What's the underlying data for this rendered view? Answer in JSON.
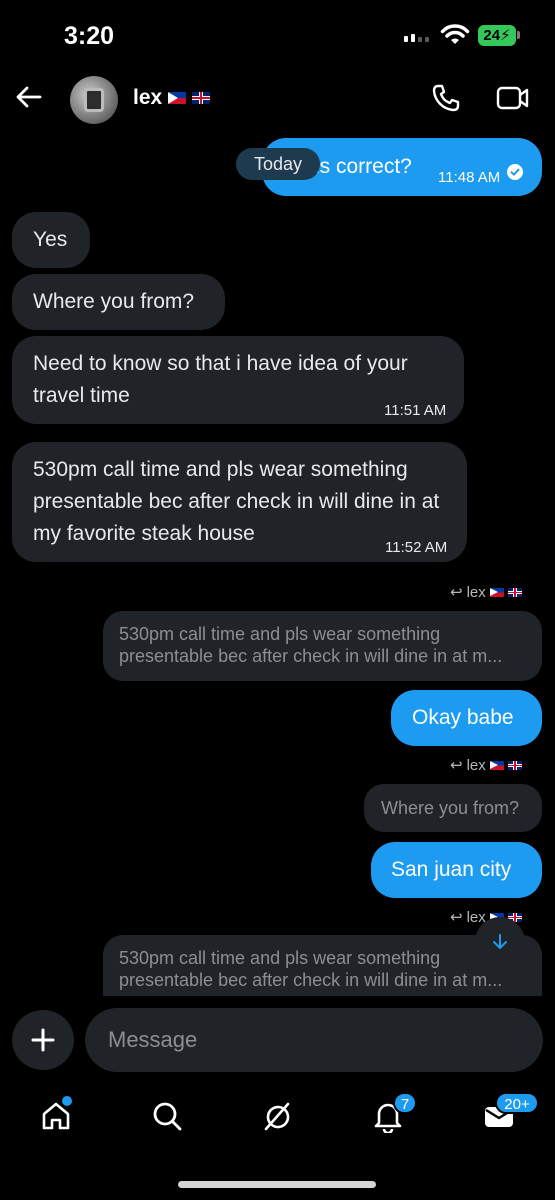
{
  "status_bar": {
    "time": "3:20",
    "battery": "24"
  },
  "header": {
    "contact_name": "lex",
    "back_icon": "arrow-left-icon",
    "call_icon": "phone-icon",
    "video_icon": "video-icon"
  },
  "date_separator": "Today",
  "messages": [
    {
      "direction": "out",
      "text": "is correct?",
      "time": "11:48 AM"
    },
    {
      "direction": "in",
      "text": "Yes"
    },
    {
      "direction": "in",
      "text": "Where you from?"
    },
    {
      "direction": "in",
      "text": "Need to know so that i have idea of your travel time",
      "time": "11:51 AM"
    },
    {
      "direction": "in",
      "text": "530pm call time and pls wear something presentable bec after check in will dine in at my favorite steak house",
      "time": "11:52 AM"
    },
    {
      "direction": "out",
      "reply_to": "lex",
      "quoted": "530pm call time and pls wear something presentable bec after check in will dine in at m...",
      "text": "Okay babe"
    },
    {
      "direction": "out",
      "reply_to": "lex",
      "quoted": "Where you from?",
      "text": "San juan city"
    },
    {
      "direction": "out",
      "reply_to": "lex",
      "quoted": "530pm call time and pls wear something presentable bec after check in will dine in at m..."
    }
  ],
  "composer": {
    "placeholder": "Message"
  },
  "bottom_nav": {
    "items": [
      "home-icon",
      "search-icon",
      "grok-icon",
      "notifications-icon",
      "messages-icon"
    ],
    "notifications_badge": "7",
    "messages_badge": "20+"
  },
  "colors": {
    "accent": "#1d9bf0",
    "incoming_bubble": "#202327",
    "background": "#000000"
  }
}
